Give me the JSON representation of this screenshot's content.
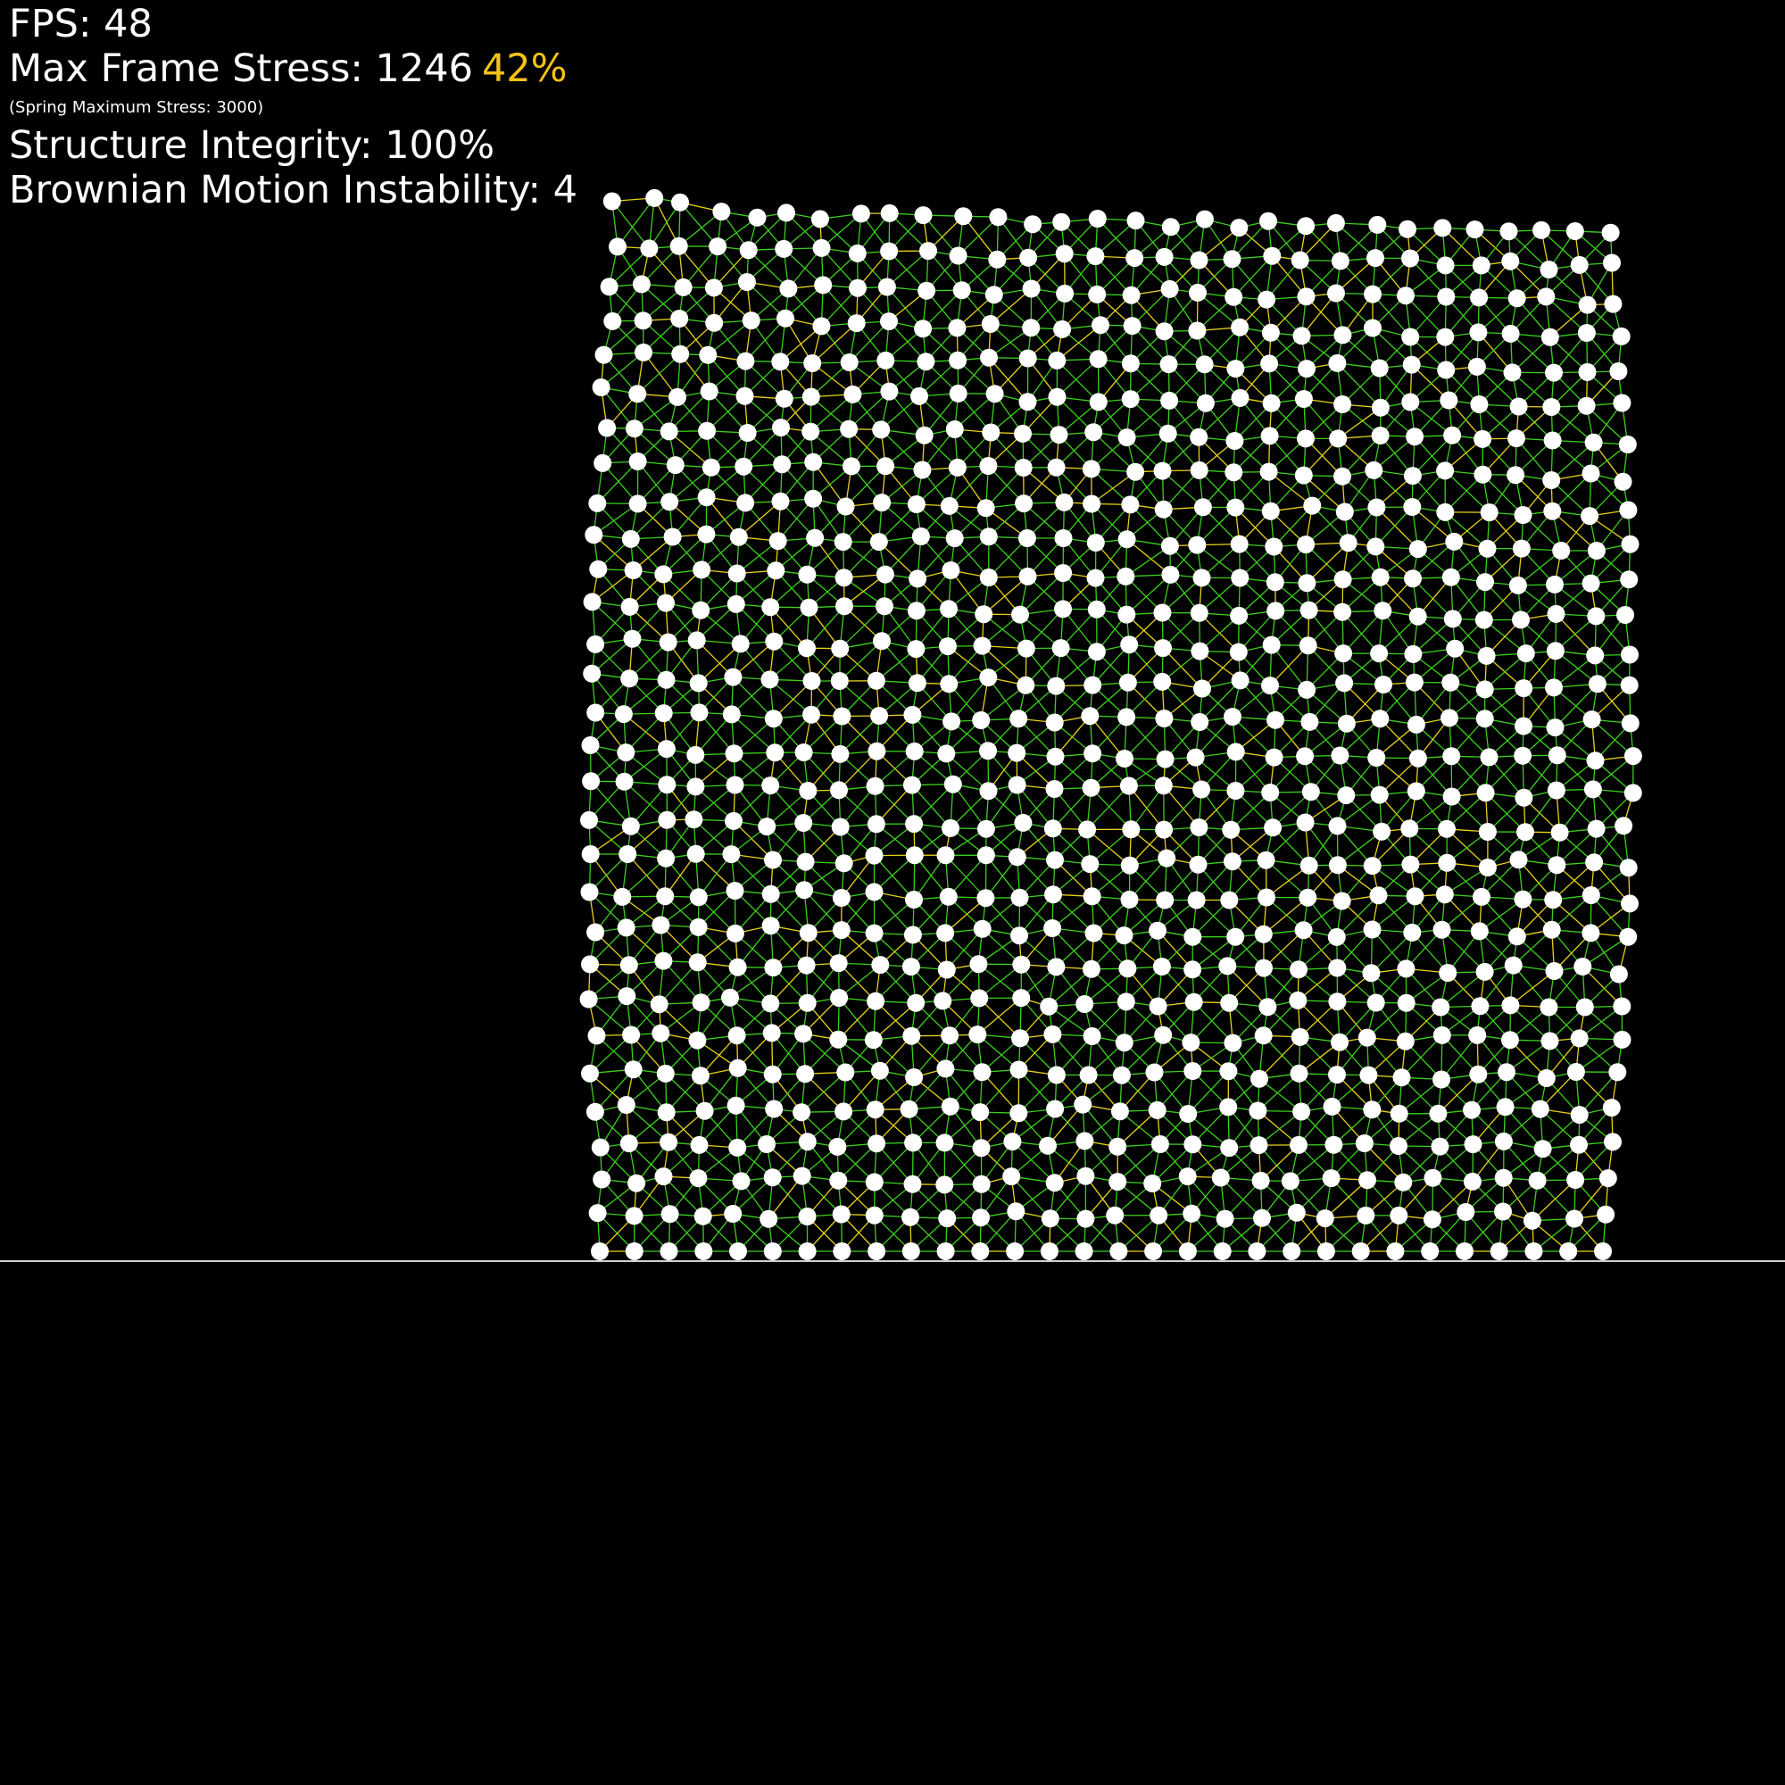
{
  "hud": {
    "fps_label": "FPS: 48",
    "max_frame_stress_label": "Max Frame Stress: 1246",
    "max_frame_stress_percent": "42%",
    "spring_max_stress_note": "(Spring Maximum Stress: 3000)",
    "structure_integrity_label": "Structure Integrity: 100%",
    "brownian_motion_label": "Brownian Motion Instability: 4"
  },
  "simulation": {
    "columns": 30,
    "rows": 30,
    "brownian_instability": 4,
    "colors": {
      "background": "#000000",
      "node": "#ffffff",
      "spring_low_stress": "#3ad01c",
      "spring_high_stress": "#e6d21a",
      "ground": "#cfcfcf",
      "stress_percent": "#f2c318"
    }
  }
}
